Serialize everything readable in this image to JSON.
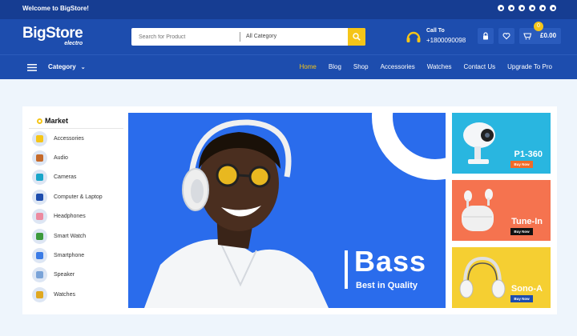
{
  "topbar": {
    "welcome": "Welcome to BigStore!",
    "social_icons": [
      "facebook-icon",
      "pinterest-icon",
      "twitter-icon",
      "instagram-icon",
      "youtube-icon",
      "skype-icon"
    ]
  },
  "header": {
    "logo": {
      "brand": "BigStore",
      "sub": "electro"
    },
    "search": {
      "placeholder": "Search for Product",
      "category": "All Category"
    },
    "call": {
      "label": "Call To",
      "number": "+1800090098"
    },
    "cart": {
      "total": "£0.00",
      "count": "0"
    }
  },
  "nav": {
    "category_label": "Category",
    "items": [
      "Home",
      "Blog",
      "Shop",
      "Accessories",
      "Watches",
      "Contact Us",
      "Upgrade To Pro"
    ],
    "active": "Home"
  },
  "sidebar": {
    "title": "Market",
    "items": [
      {
        "label": "Accessories",
        "color": "#f5c518"
      },
      {
        "label": "Audio",
        "color": "#c56a2a"
      },
      {
        "label": "Cameras",
        "color": "#1aa6c9"
      },
      {
        "label": "Computer & Laptop",
        "color": "#1d4dae"
      },
      {
        "label": "Headphones",
        "color": "#ec8aa0"
      },
      {
        "label": "Smart Watch",
        "color": "#3c9a3c"
      },
      {
        "label": "Smartphone",
        "color": "#3a7be6"
      },
      {
        "label": "Speaker",
        "color": "#7aa3d8"
      },
      {
        "label": "Watches",
        "color": "#e0a820"
      }
    ]
  },
  "hero": {
    "title": "Bass",
    "subtitle": "Best in Quality"
  },
  "promos": [
    {
      "name": "P1-360",
      "button": "Buy Now",
      "bg": "#29b6e0",
      "btn_color": "#f06a27"
    },
    {
      "name": "Tune-In",
      "button": "Buy Now",
      "bg": "#f5734f",
      "btn_color": "#111111"
    },
    {
      "name": "Sono-A",
      "button": "Buy Now",
      "bg": "#f5cf32",
      "btn_color": "#1d4dae"
    }
  ],
  "colors": {
    "primary": "#1d4dae",
    "topbar": "#163d92",
    "accent": "#f5c518",
    "hero": "#2a6cec"
  }
}
